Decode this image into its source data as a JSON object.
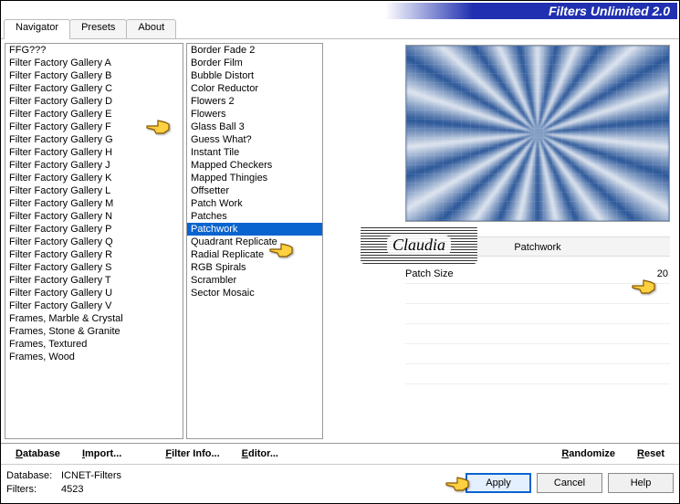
{
  "title": "Filters Unlimited 2.0",
  "tabs": [
    "Navigator",
    "Presets",
    "About"
  ],
  "active_tab": 0,
  "categories": [
    "FFG???",
    "Filter Factory Gallery A",
    "Filter Factory Gallery B",
    "Filter Factory Gallery C",
    "Filter Factory Gallery D",
    "Filter Factory Gallery E",
    "Filter Factory Gallery F",
    "Filter Factory Gallery G",
    "Filter Factory Gallery H",
    "Filter Factory Gallery J",
    "Filter Factory Gallery K",
    "Filter Factory Gallery L",
    "Filter Factory Gallery M",
    "Filter Factory Gallery N",
    "Filter Factory Gallery P",
    "Filter Factory Gallery Q",
    "Filter Factory Gallery R",
    "Filter Factory Gallery S",
    "Filter Factory Gallery T",
    "Filter Factory Gallery U",
    "Filter Factory Gallery V",
    "Frames, Marble & Crystal",
    "Frames, Stone & Granite",
    "Frames, Textured",
    "Frames, Wood"
  ],
  "filters": [
    "Border Fade 2",
    "Border Film",
    "Bubble Distort",
    "Color Reductor",
    "Flowers 2",
    "Flowers",
    "Glass Ball 3",
    "Guess What?",
    "Instant Tile",
    "Mapped Checkers",
    "Mapped Thingies",
    "Offsetter",
    "Patch Work",
    "Patches",
    "Patchwork",
    "Quadrant Replicate",
    "Radial Replicate",
    "RGB Spirals",
    "Scrambler",
    "Sector Mosaic"
  ],
  "selected_filter_index": 14,
  "selected_filter": "Patchwork",
  "param": {
    "label": "Patch Size",
    "value": "20"
  },
  "toolbar": {
    "database": "Database",
    "import": "Import...",
    "filter_info": "Filter Info...",
    "editor": "Editor...",
    "randomize": "Randomize",
    "reset": "Reset"
  },
  "footer": {
    "db_label": "Database:",
    "db_name": "ICNET-Filters",
    "filters_label": "Filters:",
    "filters_count": "4523"
  },
  "buttons": {
    "apply": "Apply",
    "cancel": "Cancel",
    "help": "Help"
  },
  "watermark": "Claudia"
}
